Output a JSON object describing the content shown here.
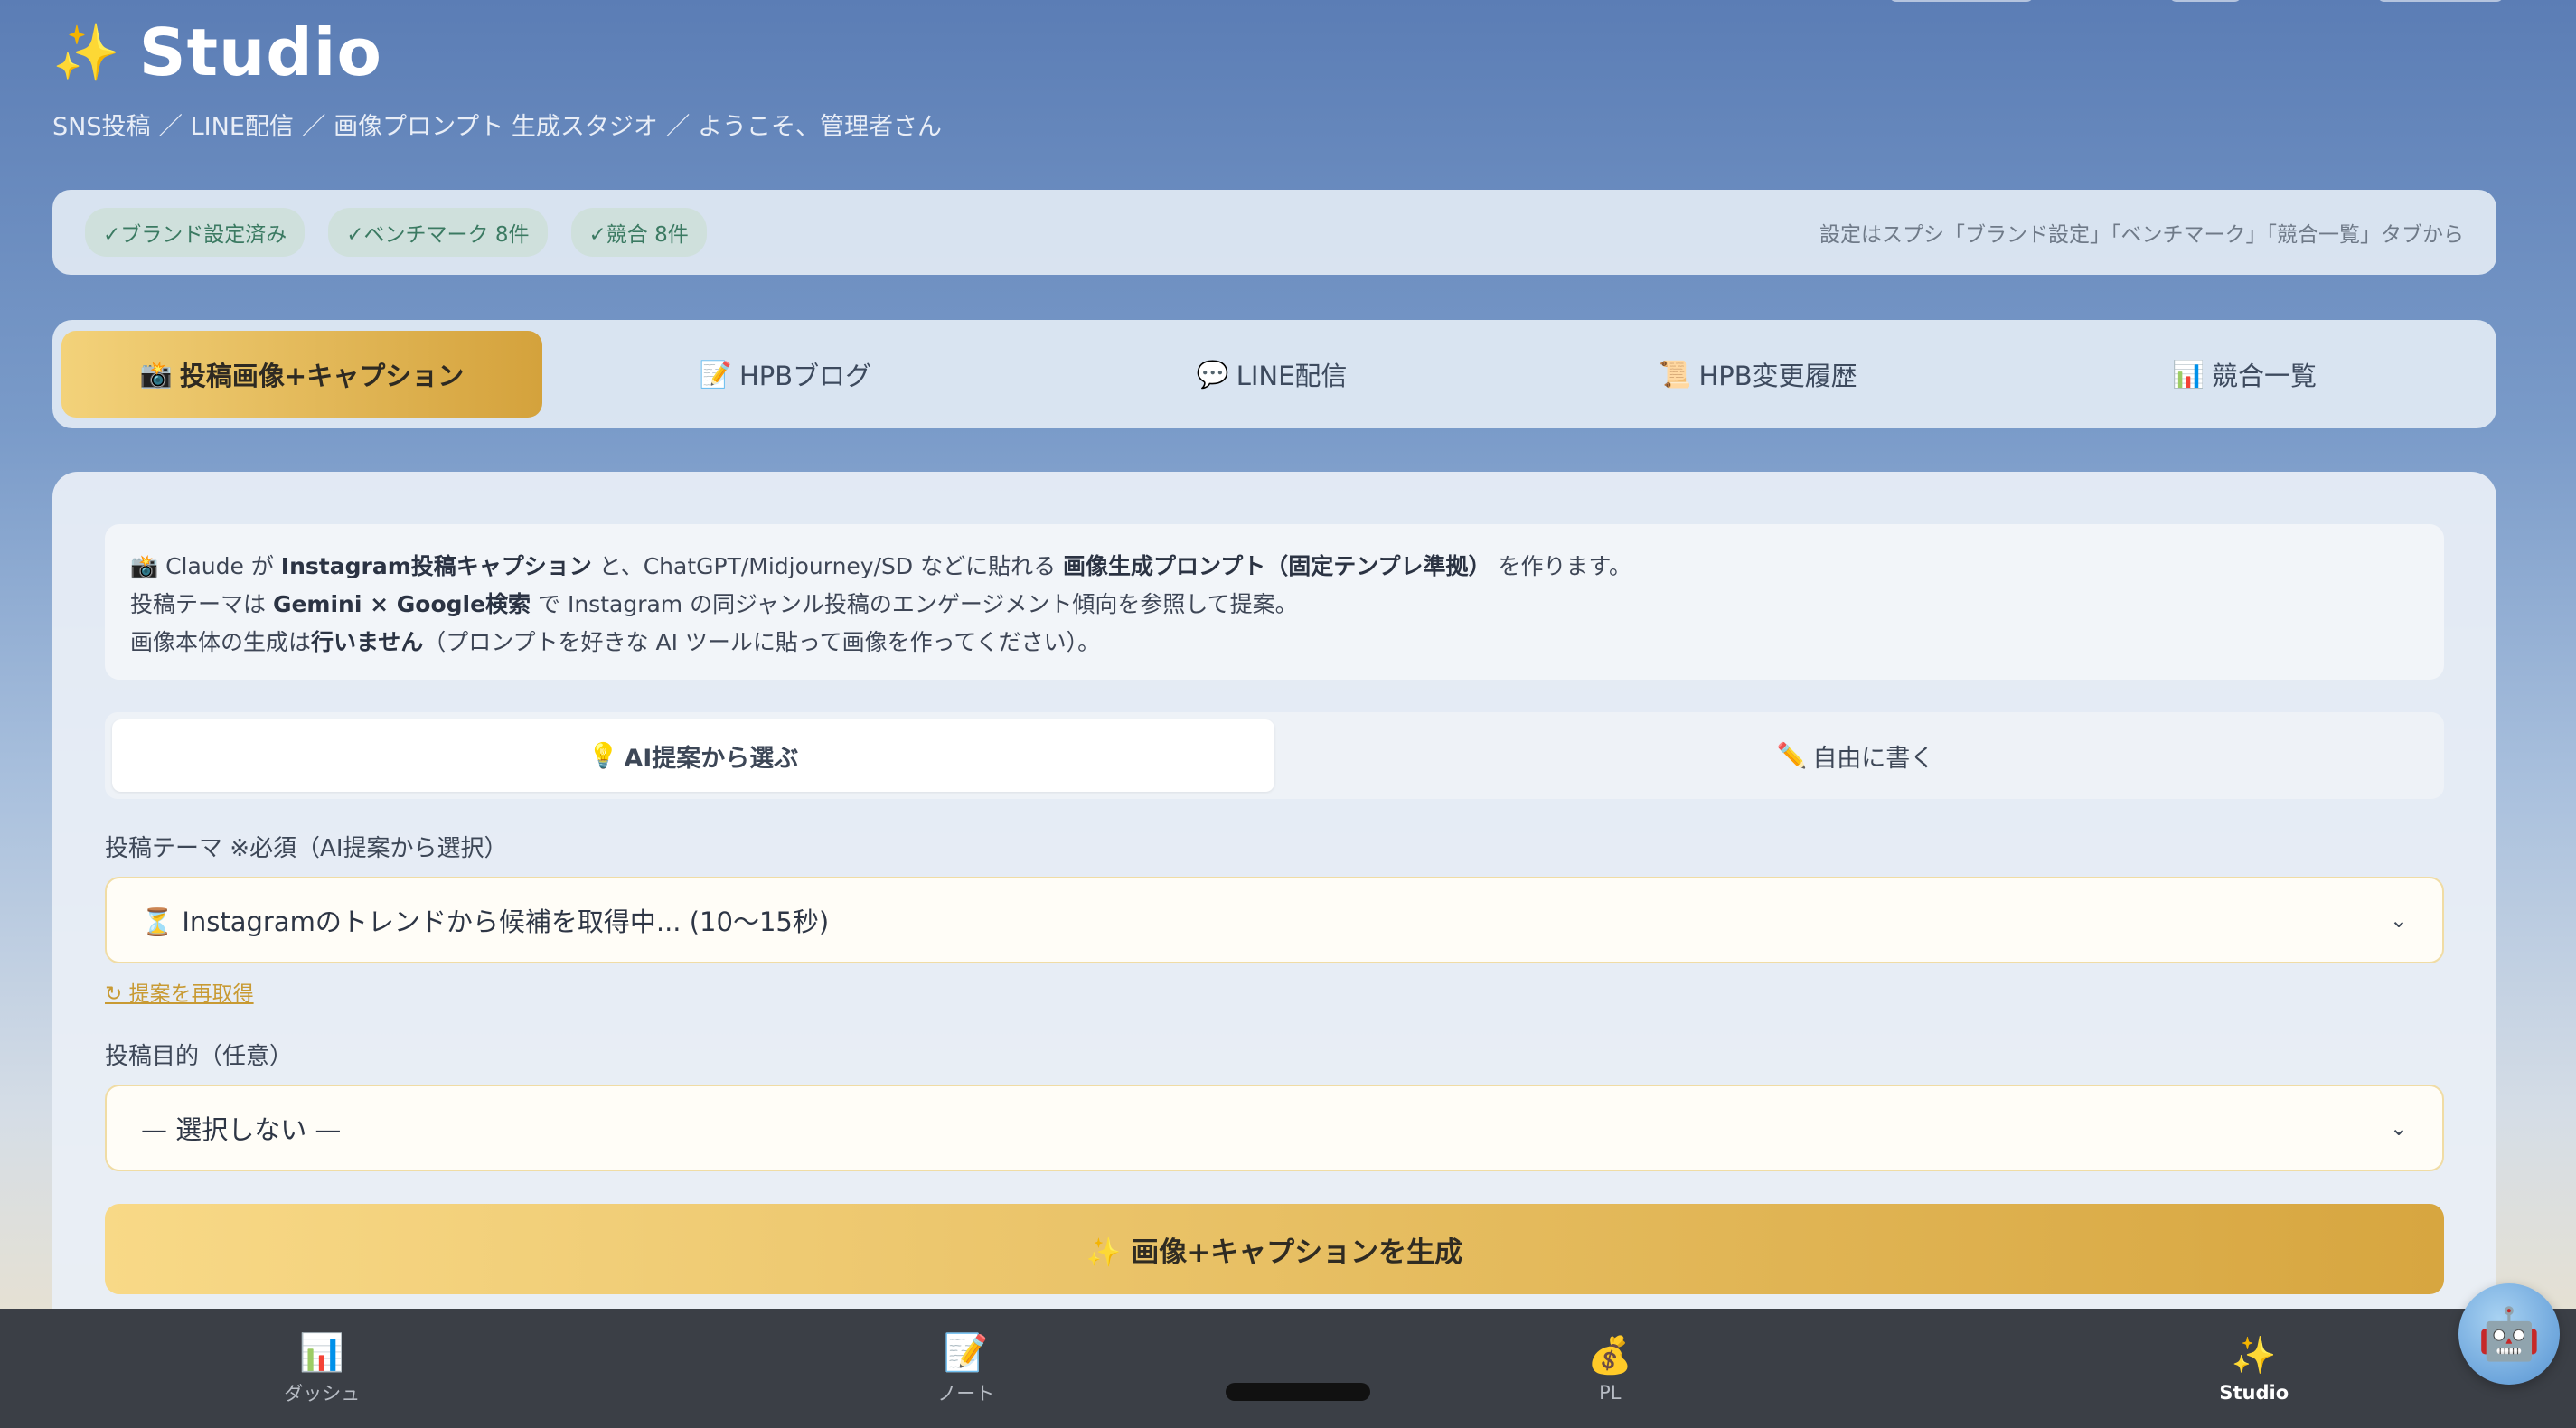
{
  "header": {
    "icon": "sparkles-icon",
    "title": "Studio",
    "subtitle": "SNS投稿 ／ LINE配信 ／ 画像プロンプト 生成スタジオ ／ ようこそ、管理者さん"
  },
  "status": {
    "badges": [
      "✓ブランド設定済み",
      "✓ベンチマーク 8件",
      "✓競合 8件"
    ],
    "note": "設定はスプシ「ブランド設定」「ベンチマーク」「競合一覧」タブから"
  },
  "tabs": [
    {
      "icon": "📸",
      "label": "投稿画像+キャプション"
    },
    {
      "icon": "📝",
      "label": "HPBブログ"
    },
    {
      "icon": "💬",
      "label": "LINE配信"
    },
    {
      "icon": "📜",
      "label": "HPB変更履歴"
    },
    {
      "icon": "📊",
      "label": "競合一覧"
    }
  ],
  "info": {
    "line1_a": "📸 Claude が ",
    "line1_b": "Instagram投稿キャプション",
    "line1_c": " と、ChatGPT/Midjourney/SD などに貼れる ",
    "line1_d": "画像生成プロンプト（固定テンプレ準拠）",
    "line1_e": " を作ります。",
    "line2_a": "投稿テーマは ",
    "line2_b": "Gemini × Google検索",
    "line2_c": " で Instagram の同ジャンル投稿のエンゲージメント傾向を参照して提案。",
    "line3_a": "画像本体の生成は",
    "line3_b": "行いません",
    "line3_c": "（プロンプトを好きな AI ツールに貼って画像を作ってください）。"
  },
  "mode": {
    "ai": {
      "icon": "💡",
      "label": "AI提案から選ぶ"
    },
    "free": {
      "icon": "✏️",
      "label": "自由に書く"
    }
  },
  "form": {
    "theme_label": "投稿テーマ ※必須（AI提案から選択）",
    "theme_value": "⏳ Instagramのトレンドから候補を取得中... (10〜15秒)",
    "refetch": "↻ 提案を再取得",
    "purpose_label": "投稿目的（任意）",
    "purpose_value": "— 選択しない —",
    "generate": "✨ 画像+キャプションを生成"
  },
  "bottom_nav": [
    {
      "icon": "📊",
      "label": "ダッシュ"
    },
    {
      "icon": "📝",
      "label": "ノート"
    },
    {
      "icon": "💰",
      "label": "PL"
    },
    {
      "icon": "✨",
      "label": "Studio"
    }
  ],
  "assistant": {
    "icon": "🤖"
  }
}
